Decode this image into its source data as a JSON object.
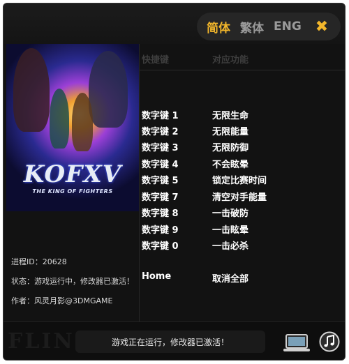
{
  "language_bar": {
    "simplified": "简体",
    "traditional": "繁体",
    "english": "ENG",
    "close_glyph": "✖"
  },
  "cover": {
    "logo_text": "KOFXV",
    "logo_subtitle": "THE KING OF FIGHTERS"
  },
  "table": {
    "header_key": "快捷键",
    "header_function": "对应功能",
    "rows": [
      {
        "key": "数字键 1",
        "function": "无限生命"
      },
      {
        "key": "数字键 2",
        "function": "无限能量"
      },
      {
        "key": "数字键 3",
        "function": "无限防御"
      },
      {
        "key": "数字键 4",
        "function": "不会眩晕"
      },
      {
        "key": "数字键 5",
        "function": "锁定比赛时间"
      },
      {
        "key": "数字键 7",
        "function": "清空对手能量"
      },
      {
        "key": "数字键 8",
        "function": "一击破防"
      },
      {
        "key": "数字键 9",
        "function": "一击眩晕"
      },
      {
        "key": "数字键 0",
        "function": "一击必杀"
      },
      {
        "key": "Home",
        "function": "取消全部"
      }
    ]
  },
  "info": {
    "process_id": "进程ID：20628",
    "status": "状态：游戏运行中，修改器已激活！",
    "author": "作者：风灵月影@3DMGAME"
  },
  "footer": {
    "brand": "FLING",
    "status_message": "游戏正在运行，修改器已激活！"
  },
  "colors": {
    "accent": "#f2b62b",
    "background": "#121212",
    "text": "#ffffff"
  },
  "icons": [
    "close-icon",
    "laptop-icon",
    "music-icon"
  ]
}
